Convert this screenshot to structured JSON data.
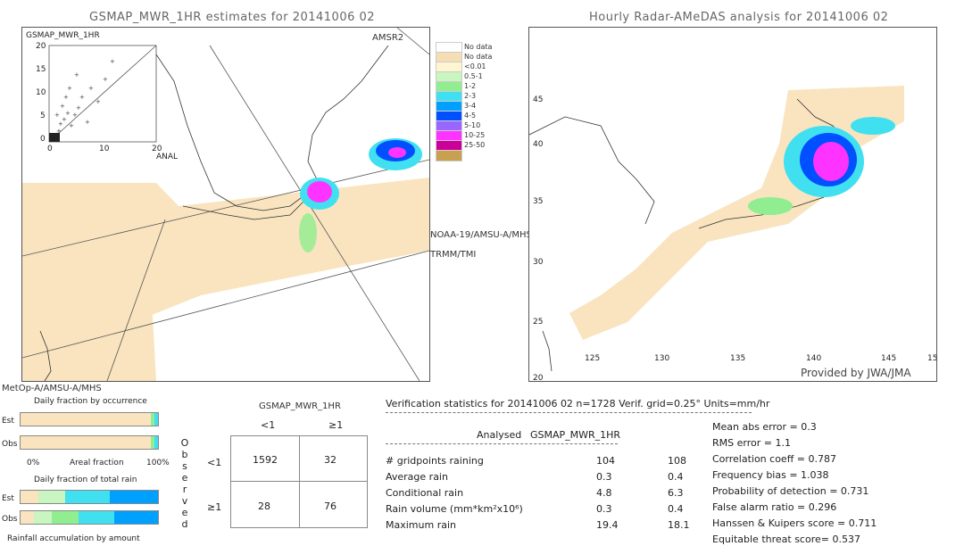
{
  "left_panel": {
    "title": "GSMAP_MWR_1HR estimates for 20141006 02",
    "scatter": {
      "y_label": "GSMAP_MWR_1HR",
      "x_label": "ANAL",
      "y_ticks": [
        "20",
        "15",
        "10",
        "5",
        "0"
      ],
      "x_ticks": [
        "0",
        "10",
        "20"
      ]
    },
    "satellite_labels": {
      "amsr2": "AMSR2",
      "noaa19": "NOAA-19/AMSU-A/MHS",
      "trmm": "TRMM/TMI",
      "metop": "MetOp-A/AMSU-A/MHS"
    }
  },
  "legend": {
    "items": [
      {
        "label": "No data",
        "color": "#ffffff"
      },
      {
        "label": "No data",
        "color": "#f5deb3"
      },
      {
        "label": "<0.01",
        "color": "#fff5d0"
      },
      {
        "label": "0.5-1",
        "color": "#c8f5c0"
      },
      {
        "label": "1-2",
        "color": "#90ee90"
      },
      {
        "label": "2-3",
        "color": "#40e0f0"
      },
      {
        "label": "3-4",
        "color": "#00a0ff"
      },
      {
        "label": "4-5",
        "color": "#0050ff"
      },
      {
        "label": "5-10",
        "color": "#9966ff"
      },
      {
        "label": "10-25",
        "color": "#ff33ff"
      },
      {
        "label": "25-50",
        "color": "#cc0099"
      },
      {
        "label": "",
        "color": "#c8a050"
      }
    ]
  },
  "right_panel": {
    "title": "Hourly Radar-AMeDAS analysis for 20141006 02",
    "lat_ticks": [
      "45",
      "40",
      "35",
      "30",
      "25",
      "20"
    ],
    "lon_ticks": [
      "125",
      "130",
      "135",
      "140",
      "145",
      "15"
    ],
    "credit": "Provided by JWA/JMA"
  },
  "daily_fraction": {
    "occurrence_title": "Daily fraction by occurrence",
    "total_rain_title": "Daily fraction of total rain",
    "accumulation_title": "Rainfall accumulation by amount",
    "est_label": "Est",
    "obs_label": "Obs",
    "axis_left": "0%",
    "axis_mid": "Areal fraction",
    "axis_right": "100%"
  },
  "contingency": {
    "title": "GSMAP_MWR_1HR",
    "col_headers": [
      "<1",
      "≥1"
    ],
    "row_headers": [
      "<1",
      "≥1"
    ],
    "side_label": "Observed",
    "cells": [
      [
        "1592",
        "32"
      ],
      [
        "28",
        "76"
      ]
    ]
  },
  "verification": {
    "header": "Verification statistics for 20141006 02   n=1728   Verif. grid=0.25°   Units=mm/hr",
    "col_analysed": "Analysed",
    "col_estimate": "GSMAP_MWR_1HR",
    "rows": [
      {
        "label": "# gridpoints raining",
        "analysed": "104",
        "estimate": "108"
      },
      {
        "label": "Average rain",
        "analysed": "0.3",
        "estimate": "0.4"
      },
      {
        "label": "Conditional rain",
        "analysed": "4.8",
        "estimate": "6.3"
      },
      {
        "label": "Rain volume (mm*km²x10⁶)",
        "analysed": "0.3",
        "estimate": "0.4"
      },
      {
        "label": "Maximum rain",
        "analysed": "19.4",
        "estimate": "18.1"
      }
    ],
    "scores": [
      "Mean abs error = 0.3",
      "RMS error = 1.1",
      "Correlation coeff = 0.787",
      "Frequency bias = 1.038",
      "Probability of detection = 0.731",
      "False alarm ratio = 0.296",
      "Hanssen & Kuipers score = 0.711",
      "Equitable threat score= 0.537"
    ]
  }
}
